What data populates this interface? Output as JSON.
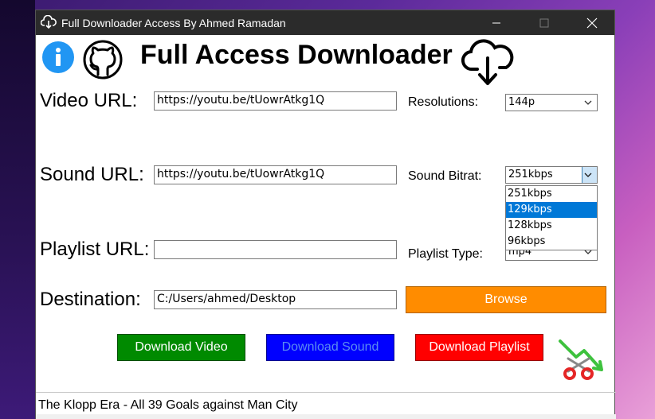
{
  "window": {
    "title": "Full Downloader Access By Ahmed Ramadan"
  },
  "header": {
    "title": "Full Access Downloader",
    "info_icon": "info-icon",
    "github_icon": "github-icon",
    "download_icon": "cloud-download-icon"
  },
  "form": {
    "video_url_label": "Video URL:",
    "video_url_value": "https://youtu.be/tUowrAtkg1Q",
    "resolutions_label": "Resolutions:",
    "resolutions_value": "144p",
    "sound_url_label": "Sound URL:",
    "sound_url_value": "https://youtu.be/tUowrAtkg1Q",
    "sound_bitrate_label": "Sound Bitrat:",
    "sound_bitrate_value": "251kbps",
    "sound_bitrate_options": [
      "251kbps",
      "129kbps",
      "128kbps",
      "96kbps"
    ],
    "sound_bitrate_highlighted": "129kbps",
    "playlist_url_label": "Playlist URL:",
    "playlist_url_value": "",
    "playlist_type_label": "Playlist Type:",
    "playlist_type_value": "mp4",
    "destination_label": "Destination:",
    "destination_value": "C:/Users/ahmed/Desktop",
    "browse_label": "Browse"
  },
  "actions": {
    "download_video_label": "Download Video",
    "download_sound_label": "Download Sound",
    "download_playlist_label": "Download Playlist",
    "trim_icon": "scissors-trim-icon"
  },
  "status": {
    "text": "The Klopp Era - All 39 Goals against Man City"
  },
  "colors": {
    "titlebar": "#2b2b2b",
    "browse": "#ff8c00",
    "download_video": "#008a00",
    "download_sound": "#0000ff",
    "download_sound_text": "#5a8cf0",
    "download_playlist": "#ff0000",
    "dropdown_highlight": "#0078d7"
  }
}
